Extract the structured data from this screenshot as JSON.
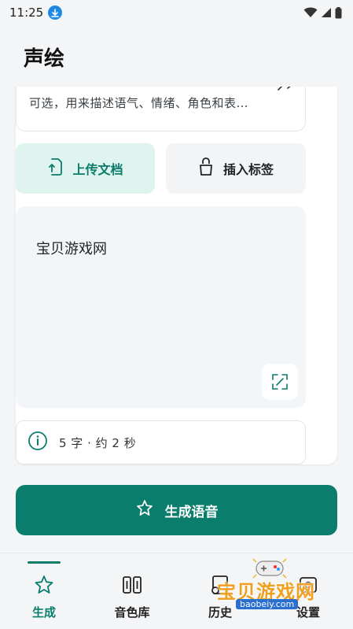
{
  "status_bar": {
    "time": "11:25"
  },
  "app": {
    "title": "声绘"
  },
  "hint": {
    "text": "可选，用来描述语气、情绪、角色和表…"
  },
  "actions": {
    "upload_label": "上传文档",
    "tag_label": "插入标签"
  },
  "editor": {
    "content": "宝贝游戏网"
  },
  "info": {
    "text": "5 字 · 约 2 秒"
  },
  "generate": {
    "label": "生成语音"
  },
  "nav": {
    "items": [
      {
        "label": "生成",
        "icon": "sparkle-icon",
        "active": true
      },
      {
        "label": "音色库",
        "icon": "library-icon",
        "active": false
      },
      {
        "label": "历史",
        "icon": "history-icon",
        "active": false
      },
      {
        "label": "设置",
        "icon": "settings-icon",
        "active": false
      }
    ]
  },
  "watermark": {
    "text": "宝贝游戏网",
    "url": "baobeiy.com"
  },
  "colors": {
    "accent": "#0a7d6d",
    "accent_light": "#dff4ef",
    "background": "#f4f5f7"
  }
}
